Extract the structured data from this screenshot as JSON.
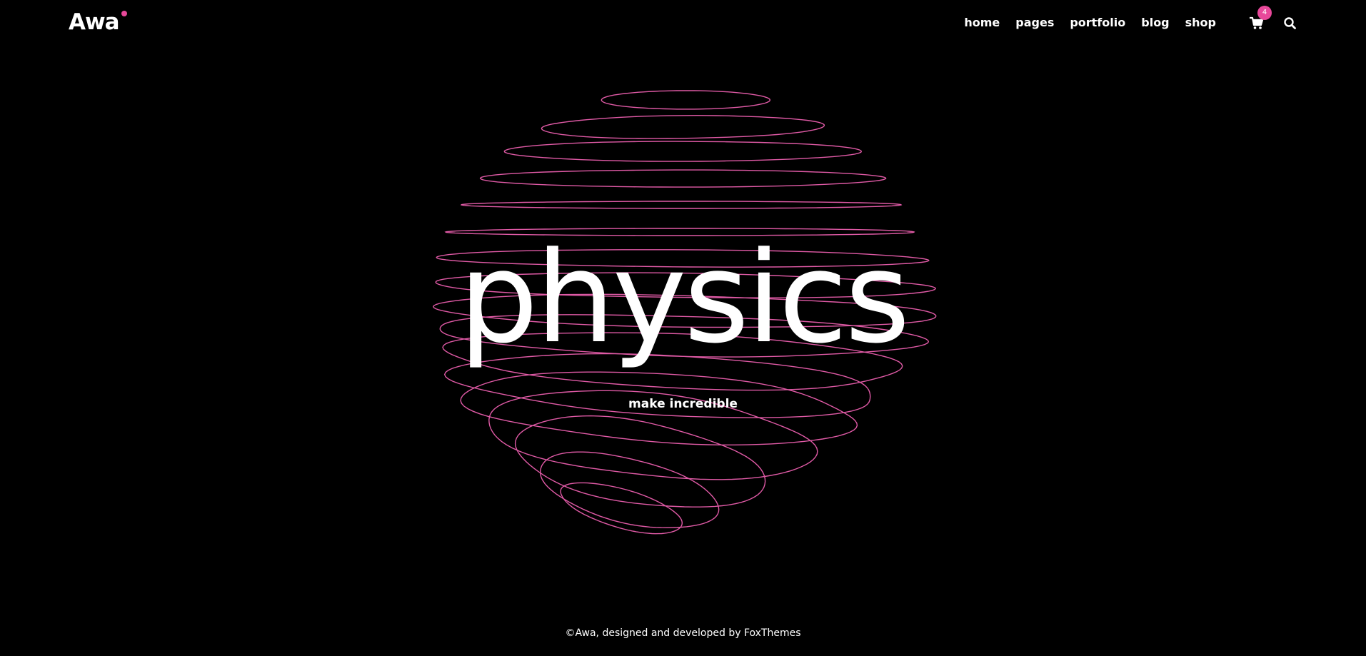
{
  "brand": {
    "name": "Awa",
    "accent_color": "#e8489a"
  },
  "nav": {
    "items": [
      {
        "label": "home"
      },
      {
        "label": "pages"
      },
      {
        "label": "portfolio"
      },
      {
        "label": "blog"
      },
      {
        "label": "shop"
      }
    ],
    "cart_icon": "shopping-cart-icon",
    "cart_count": "4",
    "search_icon": "search-icon"
  },
  "hero": {
    "title": "physics",
    "subtitle": "make incredible",
    "graphic": "wireframe-sphere",
    "line_color": "#e05aa6"
  },
  "footer": {
    "text": "©Awa, designed and developed by ",
    "link_label": "FoxThemes"
  }
}
